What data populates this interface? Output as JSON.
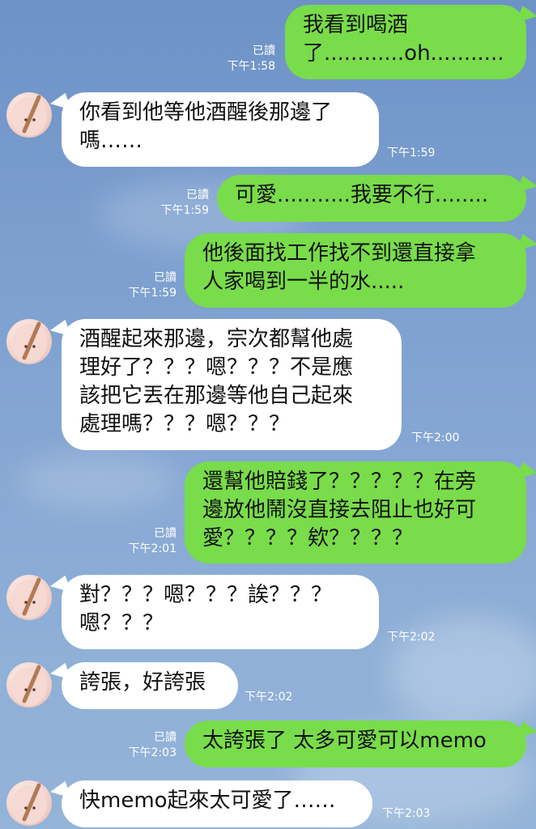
{
  "contact": {
    "avatar_icon": "pink-character-avatar-icon"
  },
  "colors": {
    "background": "#7c9fcf",
    "incoming_bubble": "#ffffff",
    "outgoing_bubble": "#79dc4a"
  },
  "messages": [
    {
      "side": "out",
      "text": "我看到喝酒\n了............oh...........",
      "read": "已讀",
      "time": "下午1:58"
    },
    {
      "side": "in",
      "text": "你看到他等他酒醒後那邊了\n嗎……",
      "time": "下午1:59"
    },
    {
      "side": "out",
      "text": "可愛...........我要不行........",
      "read": "已讀",
      "time": "下午1:59"
    },
    {
      "side": "out",
      "text": "他後面找工作找不到還直接拿\n人家喝到一半的水.....",
      "read": "已讀",
      "time": "下午1:59"
    },
    {
      "side": "in",
      "text": "酒醒起來那邊，宗次都幫他處\n理好了？？？嗯？？？不是應\n該把它丟在那邊等他自己起來\n處理嗎？？？嗯？？？",
      "time": "下午2:00"
    },
    {
      "side": "out",
      "text": "還幫他賠錢了？？？？？在旁\n邊放他鬧沒直接去阻止也好可\n愛？？？？欸？？？？",
      "read": "已讀",
      "time": "下午2:01"
    },
    {
      "side": "in",
      "text": "對？？？嗯？？？誒？？？\n嗯？？？",
      "time": "下午2:02"
    },
    {
      "side": "in",
      "text": "誇張，好誇張",
      "time": "下午2:02"
    },
    {
      "side": "out",
      "text": "太誇張了 太多可愛可以memo",
      "read": "已讀",
      "time": "下午2:03"
    },
    {
      "side": "in",
      "text": "快memo起來太可愛了……",
      "time": "下午2:03"
    }
  ]
}
